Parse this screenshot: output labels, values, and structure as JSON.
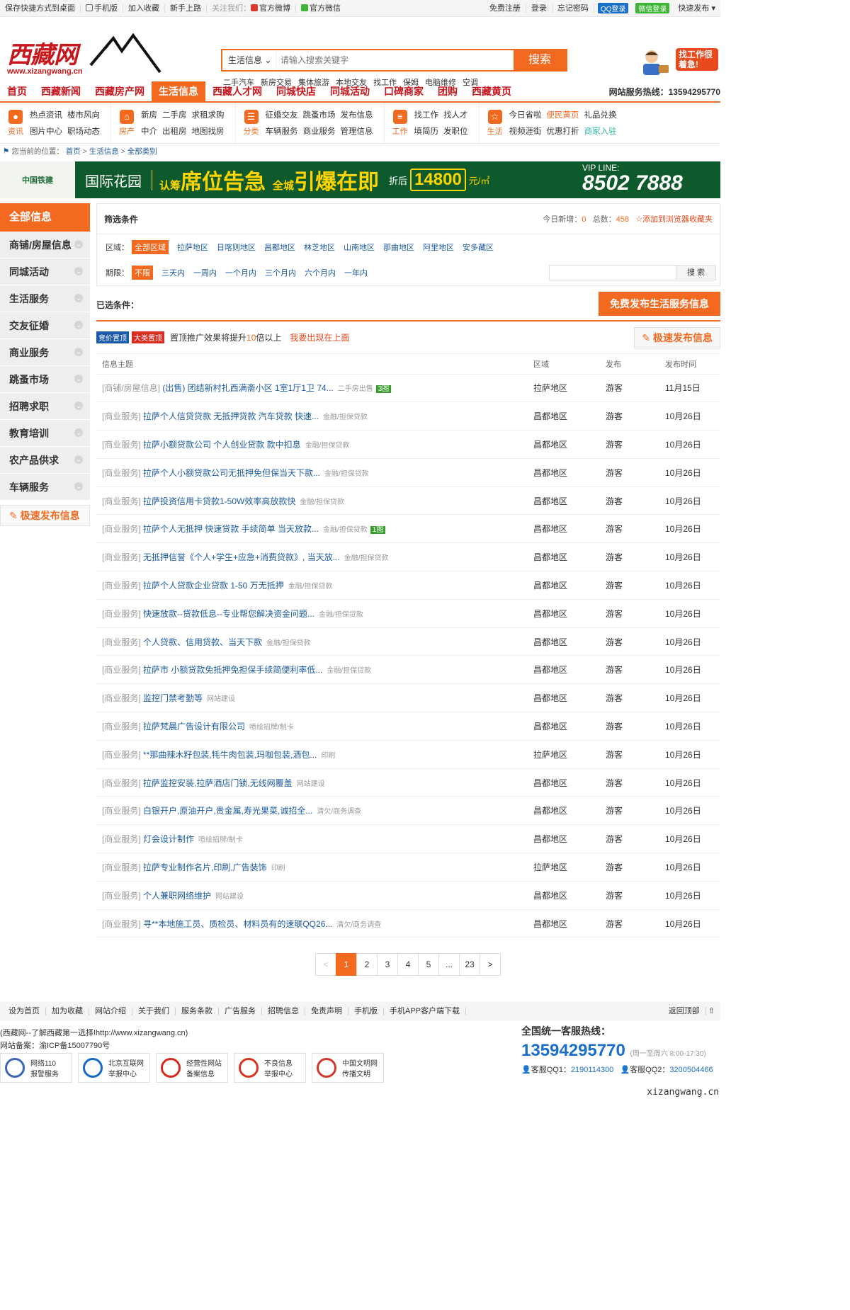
{
  "topbar": {
    "left": [
      "保存快捷方式到桌面",
      "手机版",
      "加入收藏",
      "新手上路"
    ],
    "follow_label": "关注我们：",
    "weibo": "官方微博",
    "weixin": "官方微信",
    "right": [
      "免费注册",
      "登录",
      "忘记密码"
    ],
    "qq_login": "QQ登录",
    "wx_login": "微信登录",
    "quick_post": "快速发布"
  },
  "logo": {
    "cn": "西藏网",
    "en": "www.xizangwang.cn"
  },
  "search": {
    "category": "生活信息",
    "placeholder": "请输入搜索关键字",
    "button": "搜索"
  },
  "hotwords": [
    "二手汽车",
    "新房交易",
    "集体旅游",
    "本地交友",
    "找工作",
    "保姆",
    "电脑维修",
    "空调"
  ],
  "ad_job": "找工作很着急!",
  "nav": {
    "items": [
      "首页",
      "西藏新闻",
      "西藏房产网",
      "生活信息",
      "西藏人才网",
      "同城快店",
      "同城活动",
      "口碑商家",
      "团购",
      "西藏黄页"
    ],
    "active": "生活信息",
    "hotline_label": "网站服务热线：",
    "hotline": "13594295770"
  },
  "subnav": [
    {
      "icon": "资讯",
      "rows": [
        [
          "热点资讯",
          "楼市风向"
        ],
        [
          "图片中心",
          "职场动态"
        ]
      ]
    },
    {
      "icon": "房产",
      "rows": [
        [
          "新房",
          "二手房",
          "求租求购"
        ],
        [
          "中介",
          "出租房",
          "地图找房"
        ]
      ]
    },
    {
      "icon": "分类",
      "rows": [
        [
          "征婚交友",
          "跳蚤市场",
          "发布信息"
        ],
        [
          "车辆服务",
          "商业服务",
          "管理信息"
        ]
      ]
    },
    {
      "icon": "工作",
      "rows": [
        [
          "找工作",
          "找人才"
        ],
        [
          "填简历",
          "发职位"
        ]
      ]
    },
    {
      "icon": "生活",
      "rows": [
        [
          "今日省啦",
          "便民黄页",
          "礼品兑换"
        ],
        [
          "视频涯街",
          "优惠打折",
          "商家入驻"
        ]
      ]
    }
  ],
  "breadcrumb": {
    "label": "您当前的位置：",
    "items": [
      "首页",
      "生活信息",
      "全部类别"
    ]
  },
  "banner": {
    "brand": "中国铁建",
    "project": "国际花园",
    "slogan1_pre": "认筹",
    "slogan1": "席位告急",
    "slogan2_pre": "全城",
    "slogan2": "引爆在即",
    "discount_label": "折后",
    "price": "14800",
    "unit": "元/㎡",
    "vip_label": "VIP LINE:",
    "vip_number": "8502 7888"
  },
  "sidebar": {
    "head": "全部信息",
    "items": [
      "商铺/房屋信息",
      "同城活动",
      "生活服务",
      "交友征婚",
      "商业服务",
      "跳蚤市场",
      "招聘求职",
      "教育培训",
      "农产品供求",
      "车辆服务"
    ],
    "post": "极速发布信息"
  },
  "filter": {
    "title": "筛选条件",
    "today_label": "今日新增：",
    "today": "0",
    "total_label": "总数：",
    "total": "458",
    "fav": "添加到浏览器收藏夹",
    "region_label": "区域：",
    "regions": [
      "全部区域",
      "拉萨地区",
      "日喀则地区",
      "昌都地区",
      "林芝地区",
      "山南地区",
      "那曲地区",
      "阿里地区",
      "安多藏区"
    ],
    "period_label": "期限：",
    "periods": [
      "不限",
      "三天内",
      "一周内",
      "一个月内",
      "三个月内",
      "六个月内",
      "一年内"
    ],
    "search_btn": "搜 索"
  },
  "chosen": {
    "label": "已选条件：",
    "post_btn": "免费发布生活服务信息"
  },
  "promo": {
    "tag1": "竞价置顶",
    "tag2": "大类置顶",
    "text_pre": "置顶推广效果将提升",
    "times": "10",
    "text_post": "倍以上",
    "link": "我要出现在上面",
    "post_btn": "极速发布信息"
  },
  "table": {
    "headers": [
      "信息主题",
      "区域",
      "发布",
      "发布时间"
    ],
    "rows": [
      {
        "cat": "[商铺/房屋信息]",
        "title": "(出售) 团结新村扎西满斋小区 1室1厅1卫 74...",
        "sub": "二手房出售",
        "img": "3图",
        "area": "拉萨地区",
        "by": "游客",
        "date": "11月15日"
      },
      {
        "cat": "[商业服务]",
        "title": "拉萨个人信贷贷款 无抵押贷款 汽车贷款 快速...",
        "sub": "金融/担保贷款",
        "img": "",
        "area": "昌都地区",
        "by": "游客",
        "date": "10月26日"
      },
      {
        "cat": "[商业服务]",
        "title": "拉萨小额贷款公司 个人创业贷款 款中扣息",
        "sub": "金融/担保贷款",
        "img": "",
        "area": "昌都地区",
        "by": "游客",
        "date": "10月26日"
      },
      {
        "cat": "[商业服务]",
        "title": "拉萨个人小额贷款公司无抵押免但保当天下款...",
        "sub": "金融/担保贷款",
        "img": "",
        "area": "昌都地区",
        "by": "游客",
        "date": "10月26日"
      },
      {
        "cat": "[商业服务]",
        "title": "拉萨投资信用卡贷款1-50W效率高放款快",
        "sub": "金融/担保贷款",
        "img": "",
        "area": "昌都地区",
        "by": "游客",
        "date": "10月26日"
      },
      {
        "cat": "[商业服务]",
        "title": "拉萨个人无抵押 快速贷款 手续简单 当天放款...",
        "sub": "金融/担保贷款",
        "img": "1图",
        "area": "昌都地区",
        "by": "游客",
        "date": "10月26日"
      },
      {
        "cat": "[商业服务]",
        "title": "无抵押信誉《个人+学生+应急+消费贷款》, 当天放...",
        "sub": "金融/担保贷款",
        "img": "",
        "area": "昌都地区",
        "by": "游客",
        "date": "10月26日"
      },
      {
        "cat": "[商业服务]",
        "title": "拉萨个人贷款企业贷款 1-50 万无抵押",
        "sub": "金融/担保贷款",
        "img": "",
        "area": "昌都地区",
        "by": "游客",
        "date": "10月26日"
      },
      {
        "cat": "[商业服务]",
        "title": "快速放款--贷款低息--专业帮您解决资金问题...",
        "sub": "金融/担保贷款",
        "img": "",
        "area": "昌都地区",
        "by": "游客",
        "date": "10月26日"
      },
      {
        "cat": "[商业服务]",
        "title": "个人贷款、信用贷款、当天下款",
        "sub": "金融/担保贷款",
        "img": "",
        "area": "昌都地区",
        "by": "游客",
        "date": "10月26日"
      },
      {
        "cat": "[商业服务]",
        "title": "拉萨市 小额贷款免抵押免担保手续简便利率低...",
        "sub": "金融/担保贷款",
        "img": "",
        "area": "昌都地区",
        "by": "游客",
        "date": "10月26日"
      },
      {
        "cat": "[商业服务]",
        "title": "监控门禁考勤等",
        "sub": "网站建设",
        "img": "",
        "area": "昌都地区",
        "by": "游客",
        "date": "10月26日"
      },
      {
        "cat": "[商业服务]",
        "title": "拉萨梵晨广告设计有限公司",
        "sub": "喷绘招牌/制卡",
        "img": "",
        "area": "昌都地区",
        "by": "游客",
        "date": "10月26日"
      },
      {
        "cat": "[商业服务]",
        "title": "**那曲辣木籽包装,牦牛肉包装,玛咖包装,酒包...",
        "sub": "印刷",
        "img": "",
        "area": "拉萨地区",
        "by": "游客",
        "date": "10月26日"
      },
      {
        "cat": "[商业服务]",
        "title": "拉萨监控安装,拉萨酒店门锁,无线网覆盖",
        "sub": "网站建设",
        "img": "",
        "area": "昌都地区",
        "by": "游客",
        "date": "10月26日"
      },
      {
        "cat": "[商业服务]",
        "title": "白银开户,原油开户,贵金属,寿光果菜,诚招全...",
        "sub": "清欠/商务调查",
        "img": "",
        "area": "昌都地区",
        "by": "游客",
        "date": "10月26日"
      },
      {
        "cat": "[商业服务]",
        "title": "灯会设计制作",
        "sub": "喷绘招牌/制卡",
        "img": "",
        "area": "昌都地区",
        "by": "游客",
        "date": "10月26日"
      },
      {
        "cat": "[商业服务]",
        "title": "拉萨专业制作名片,印刷,广告装饰",
        "sub": "印刷",
        "img": "",
        "area": "拉萨地区",
        "by": "游客",
        "date": "10月26日"
      },
      {
        "cat": "[商业服务]",
        "title": "个人兼职网络维护",
        "sub": "网站建设",
        "img": "",
        "area": "昌都地区",
        "by": "游客",
        "date": "10月26日"
      },
      {
        "cat": "[商业服务]",
        "title": "寻**本地施工员、质检员、材料员有的速联QQ26...",
        "sub": "清欠/商务调查",
        "img": "",
        "area": "昌都地区",
        "by": "游客",
        "date": "10月26日"
      }
    ]
  },
  "pager": {
    "prev": "<",
    "pages": [
      "1",
      "2",
      "3",
      "4",
      "5",
      "...",
      "23"
    ],
    "current": "1",
    "next": ">"
  },
  "footer": {
    "links": [
      "设为首页",
      "加为收藏",
      "网站介绍",
      "关于我们",
      "服务条款",
      "广告服务",
      "招聘信息",
      "免责声明",
      "手机版",
      "手机APP客户端下载"
    ],
    "back_top": "返回顶部",
    "line1": "(西藏网--了解西藏第一选择!http://www.xizangwang.cn)",
    "line2": "网站备案：渝ICP备15007790号",
    "badges": [
      {
        "text1": "网络110",
        "text2": "报警服务",
        "color": "#3b66b5"
      },
      {
        "text1": "北京互联网",
        "text2": "举报中心",
        "color": "#1669c9"
      },
      {
        "text1": "经营性网站",
        "text2": "备案信息",
        "color": "#d42a1c"
      },
      {
        "text1": "不良信息",
        "text2": "举报中心",
        "color": "#d6341f"
      },
      {
        "text1": "中国文明网",
        "text2": "传播文明",
        "color": "#d2372c"
      }
    ],
    "tel_label": "全国统一客服热线：",
    "tel": "13594295770",
    "tel_hours": "(周一至周六 8:00-17:30)",
    "qq1_label": "客服QQ1：",
    "qq1": "2190114300",
    "qq2_label": "客服QQ2：",
    "qq2": "3200504466",
    "watermark": "xizangwang.cn"
  }
}
